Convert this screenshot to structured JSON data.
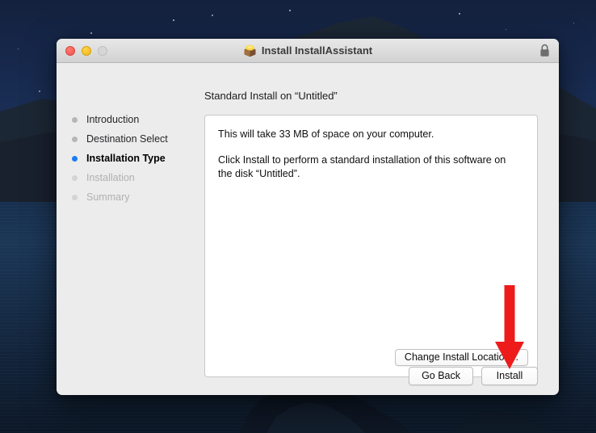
{
  "desktop": {
    "wallpaper_name": "catalina-night-wallpaper",
    "sky_color": "#1a2e55",
    "water_color": "#16304f"
  },
  "window": {
    "title": "Install InstallAssistant",
    "package_icon": "installer-package-icon",
    "lock_icon": "lock-icon",
    "traffic_lights": {
      "close": "close-button",
      "minimize": "minimize-button",
      "zoom": "zoom-button"
    }
  },
  "main": {
    "headline": "Standard Install on “Untitled”",
    "paragraphs": [
      "This will take 33 MB of space on your computer.",
      "Click Install to perform a standard installation of this software on the disk “Untitled”."
    ],
    "change_location_label": "Change Install Location..."
  },
  "sidebar": {
    "steps": [
      {
        "label": "Introduction",
        "state": "done"
      },
      {
        "label": "Destination Select",
        "state": "done"
      },
      {
        "label": "Installation Type",
        "state": "current"
      },
      {
        "label": "Installation",
        "state": "pending"
      },
      {
        "label": "Summary",
        "state": "pending"
      }
    ],
    "active_dot_color": "#1b7cf5",
    "inactive_dot_color": "#b6b6b6"
  },
  "footer": {
    "go_back_label": "Go Back",
    "install_label": "Install"
  },
  "annotation": {
    "arrow_color": "#ee1b1b",
    "points_to": "install-button"
  }
}
